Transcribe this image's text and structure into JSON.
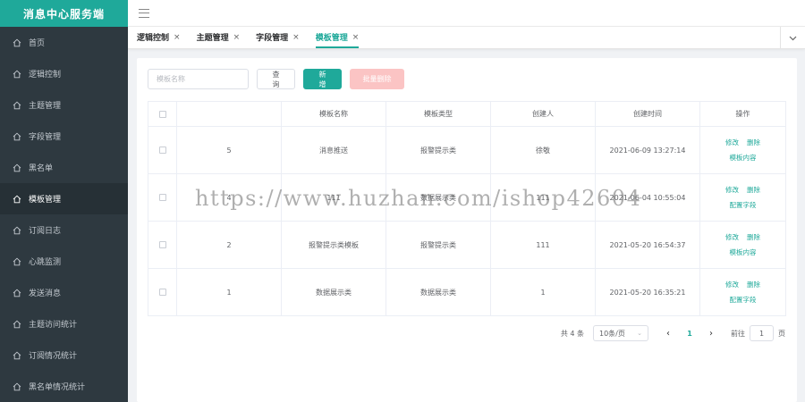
{
  "app": {
    "title": "消息中心服务端"
  },
  "sidebar": {
    "items": [
      {
        "label": "首页",
        "icon": "home-icon",
        "active": false
      },
      {
        "label": "逻辑控制",
        "icon": "home-icon",
        "active": false
      },
      {
        "label": "主题管理",
        "icon": "home-icon",
        "active": false
      },
      {
        "label": "字段管理",
        "icon": "home-icon",
        "active": false
      },
      {
        "label": "黑名单",
        "icon": "home-icon",
        "active": false
      },
      {
        "label": "模板管理",
        "icon": "home-icon",
        "active": true
      },
      {
        "label": "订阅日志",
        "icon": "home-icon",
        "active": false
      },
      {
        "label": "心跳监测",
        "icon": "home-icon",
        "active": false
      },
      {
        "label": "发送消息",
        "icon": "home-icon",
        "active": false
      },
      {
        "label": "主题访问统计",
        "icon": "home-icon",
        "active": false
      },
      {
        "label": "订阅情况统计",
        "icon": "home-icon",
        "active": false
      },
      {
        "label": "黑名单情况统计",
        "icon": "home-icon",
        "active": false
      }
    ]
  },
  "tabs": [
    {
      "label": "逻辑控制",
      "close": "×",
      "active": false
    },
    {
      "label": "主题管理",
      "close": "×",
      "active": false
    },
    {
      "label": "字段管理",
      "close": "×",
      "active": false
    },
    {
      "label": "模板管理",
      "close": "×",
      "active": true
    }
  ],
  "search": {
    "placeholder": "模板名称",
    "query_label": "查询",
    "add_label": "新增",
    "batch_delete_label": "批量删除"
  },
  "table": {
    "columns": [
      "",
      "",
      "模板名称",
      "模板类型",
      "创建人",
      "创建时间",
      "操作"
    ],
    "rows": [
      {
        "id": "5",
        "name": "消息推送",
        "type": "报警提示类",
        "creator": "徐敬",
        "created": "2021-06-09 13:27:14",
        "actions": [
          "修改",
          "删除"
        ],
        "extra": "模板内容"
      },
      {
        "id": "4",
        "name": "111",
        "type": "数据展示类",
        "creator": "111",
        "created": "2021-06-04 10:55:04",
        "actions": [
          "修改",
          "删除"
        ],
        "extra": "配置字段"
      },
      {
        "id": "2",
        "name": "报警提示类模板",
        "type": "报警提示类",
        "creator": "111",
        "created": "2021-05-20 16:54:37",
        "actions": [
          "修改",
          "删除"
        ],
        "extra": "模板内容"
      },
      {
        "id": "1",
        "name": "数据展示类",
        "type": "数据展示类",
        "creator": "1",
        "created": "2021-05-20 16:35:21",
        "actions": [
          "修改",
          "删除"
        ],
        "extra": "配置字段"
      }
    ]
  },
  "pagination": {
    "total": "共 4 条",
    "page_size": "10条/页",
    "prev": "‹",
    "current": "1",
    "next": "›",
    "goto_label": "前往",
    "goto_value": "1",
    "goto_suffix": "页"
  },
  "watermark": "https://www.huzhan.com/ishop42604",
  "colors": {
    "brand": "#1fa99a",
    "sidebar_bg": "#2e3940",
    "danger_light": "#fbc4c4"
  }
}
